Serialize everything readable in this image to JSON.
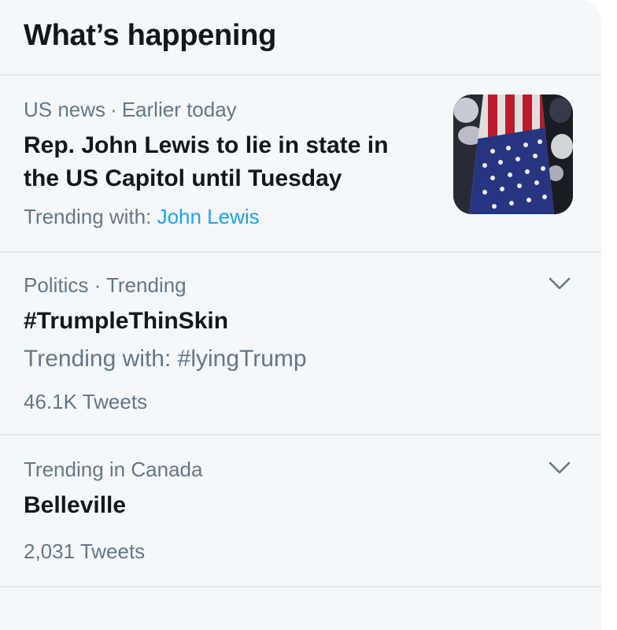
{
  "header": {
    "title": "What’s happening"
  },
  "trends": [
    {
      "category": "US news",
      "time": "Earlier today",
      "title_line1": "Rep. John Lewis to lie in state in",
      "title_line2": "the US Capitol until Tuesday",
      "trending_with_label": "Trending with:",
      "trending_with_value": "John Lewis",
      "has_image": true
    },
    {
      "meta": "Politics · Trending",
      "title": "#TrumpleThinSkin",
      "trending_with": "Trending with: #lyingTrump",
      "tweet_count": "46.1K Tweets",
      "has_menu": true
    },
    {
      "meta": "Trending in Canada",
      "title": "Belleville",
      "tweet_count": "2,031 Tweets",
      "has_menu": true
    }
  ],
  "colors": {
    "background": "#f5f8fa",
    "primary_text": "#14171a",
    "secondary_text": "#657786",
    "link": "#1da1f2",
    "divider": "#e1e8ed"
  },
  "icons": {
    "chevron": "chevron-down-icon"
  }
}
